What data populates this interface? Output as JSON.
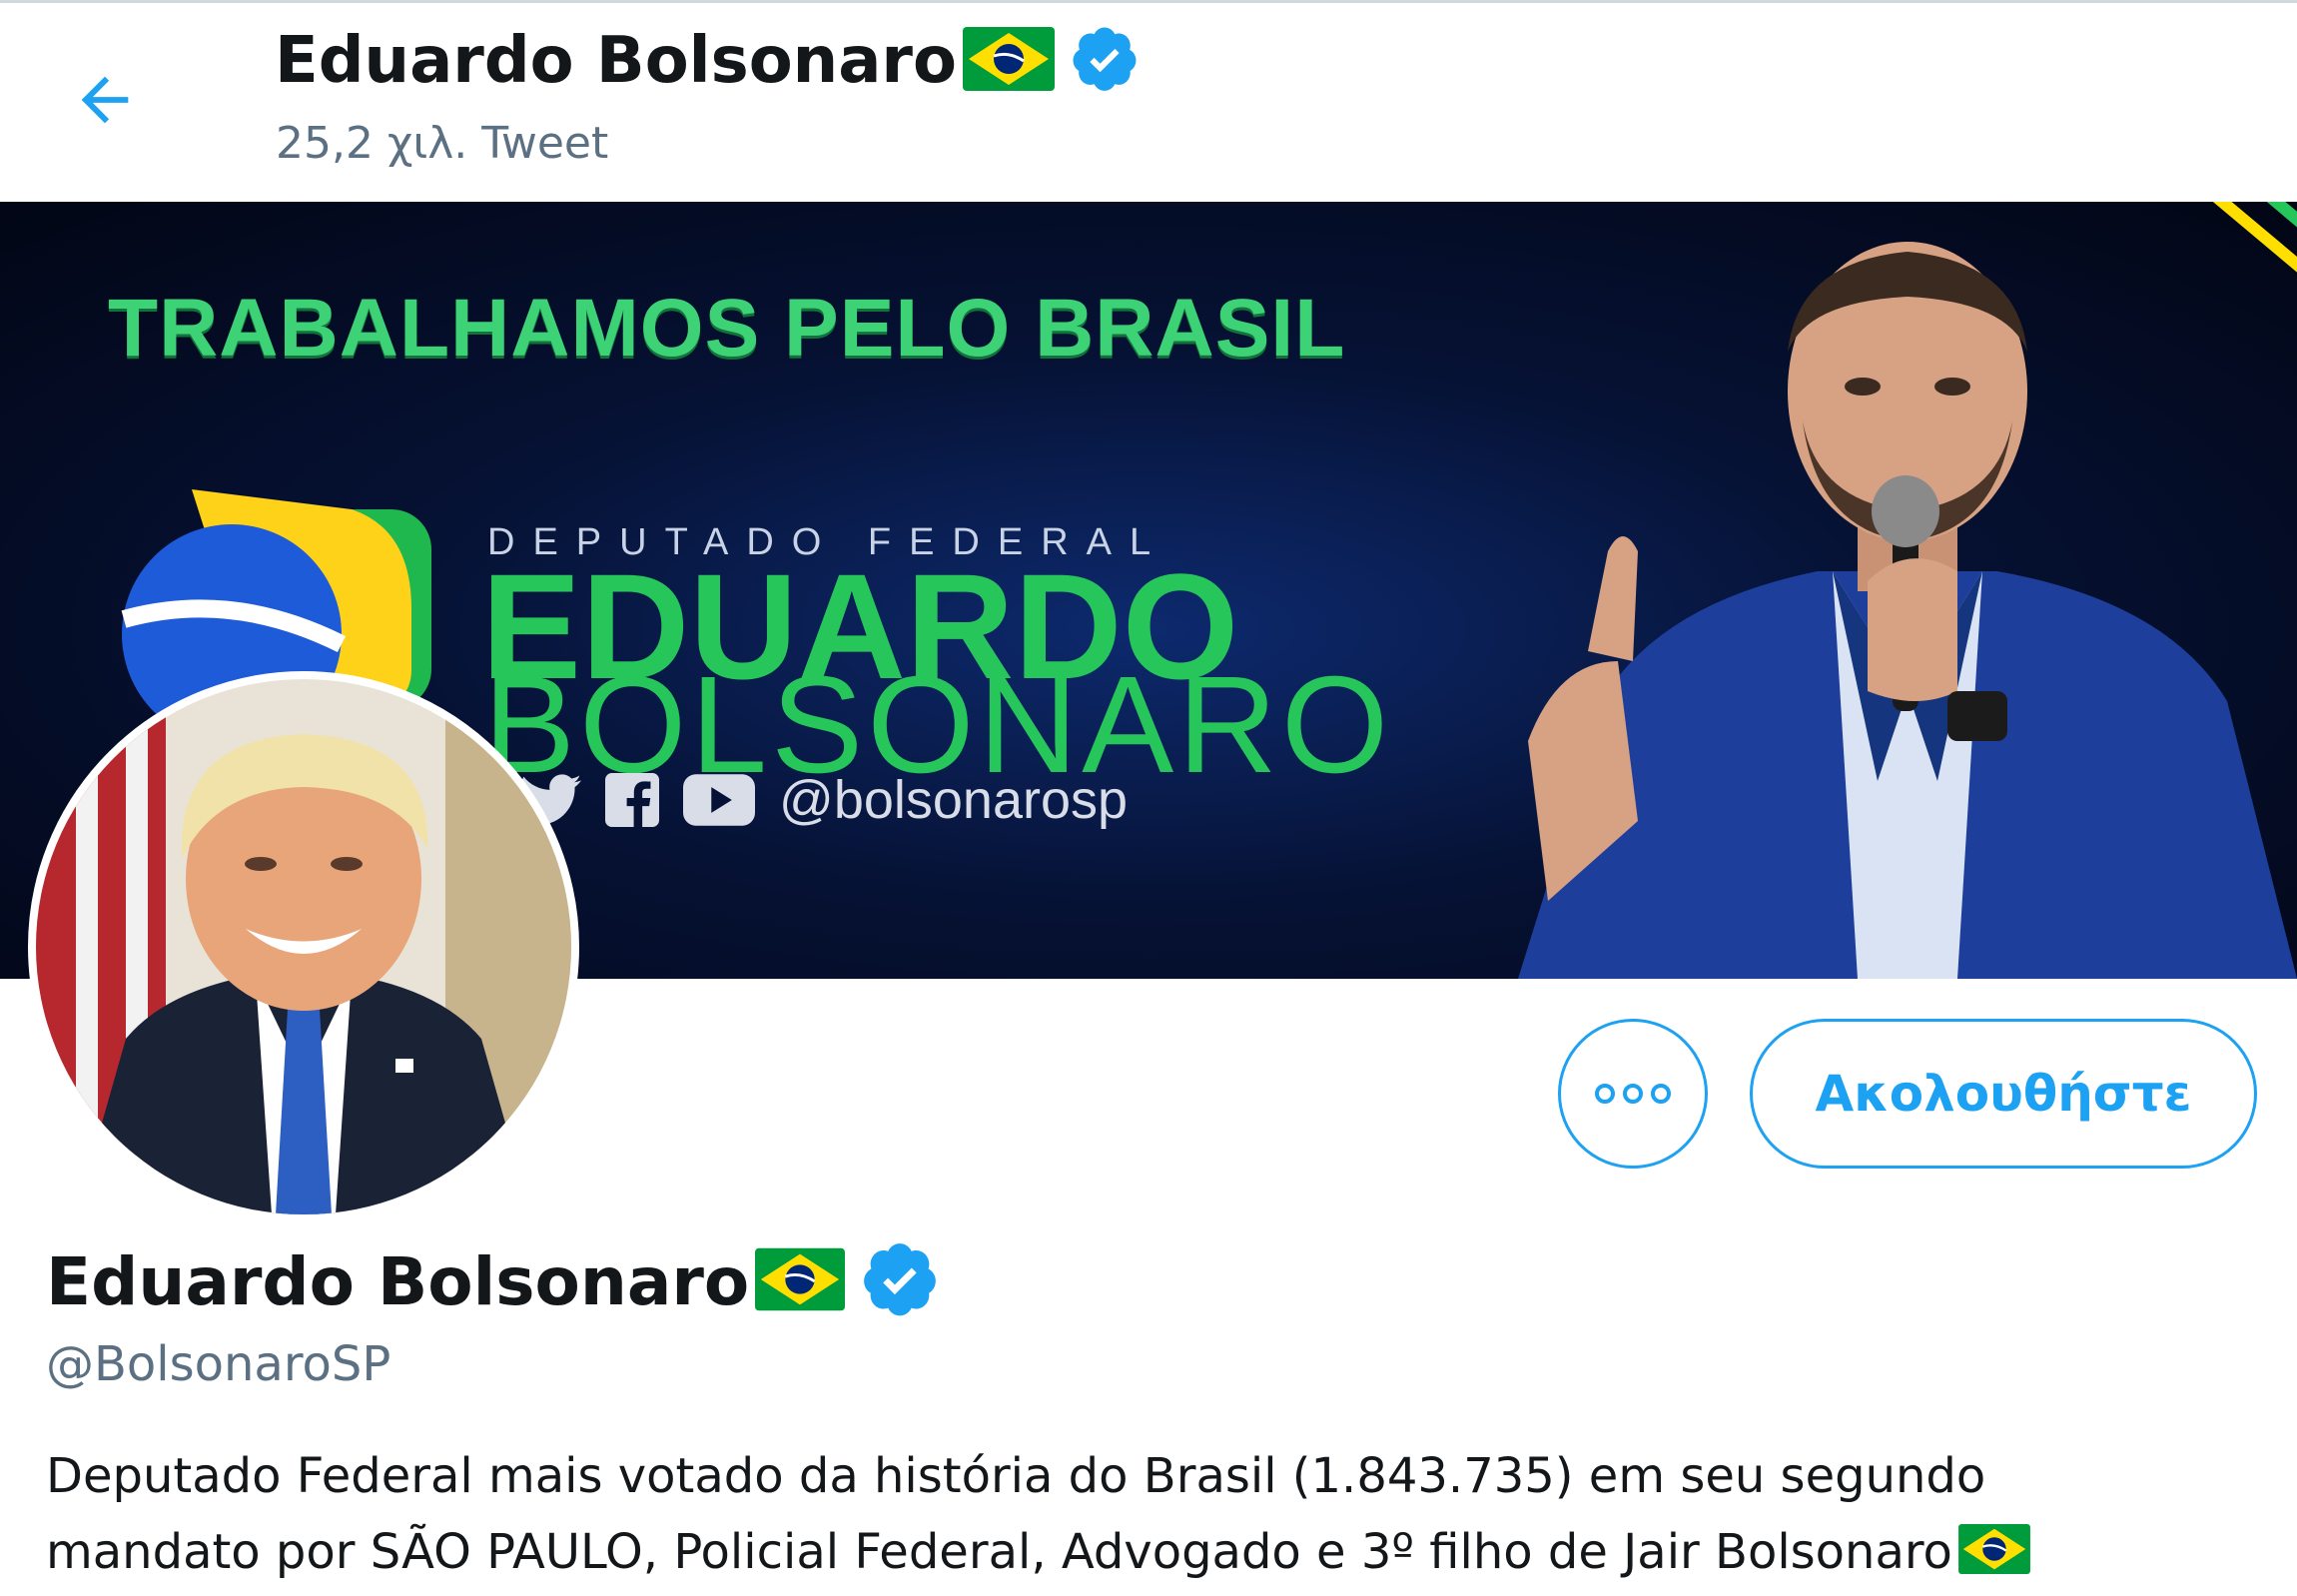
{
  "header": {
    "title": "Eduardo Bolsonaro",
    "subtitle": "25,2 χιλ. Tweet"
  },
  "banner": {
    "headline": "TRABALHAMOS PELO BRASIL",
    "role": "DEPUTADO FEDERAL",
    "name_line1": "EDUARDO",
    "name_line2": "BOLSONARO",
    "social_handle": "@bolsonarosp"
  },
  "profile": {
    "name": "Eduardo Bolsonaro",
    "handle": "@BolsonaroSP",
    "bio_line1": "Deputado Federal mais votado da história do Brasil (1.843.735) em seu segundo",
    "bio_line2": "mandato por SÃO PAULO, Policial Federal, Advogado e 3º filho de Jair Bolsonaro"
  },
  "actions": {
    "follow_label": "Ακολουθήστε"
  },
  "colors": {
    "accent": "#1da1f2",
    "text": "#14171a",
    "secondary": "#5b7083",
    "flag_green": "#009c3b",
    "flag_yellow": "#ffdf00",
    "flag_blue": "#002776"
  },
  "icons": [
    "back-arrow-icon",
    "brazil-flag-icon",
    "verified-badge-icon",
    "more-options-icon"
  ]
}
